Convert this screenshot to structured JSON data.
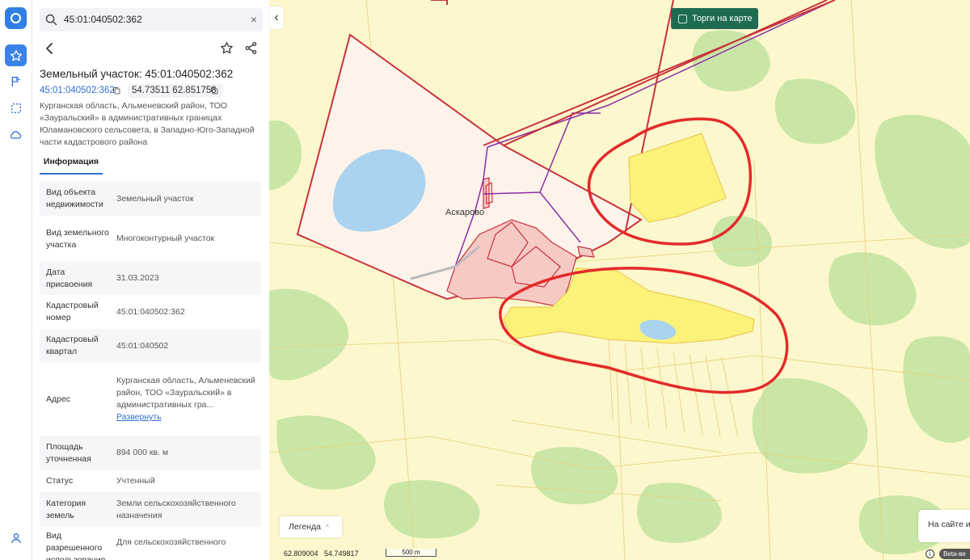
{
  "rail": {
    "icons": [
      "logo-icon",
      "star-icon",
      "route-icon",
      "selection-icon",
      "cloud-icon",
      "user-icon"
    ]
  },
  "search": {
    "value": "45:01:040502:362",
    "close_glyph": "×"
  },
  "object": {
    "title": "Земельный участок: 45:01:040502:362",
    "cadastral_link": "45:01:040502:362",
    "coords": "54.73511 62.851758",
    "address_full": "Курганская область, Альменевский район, ТОО «Зауральский» в административных границах Юламановского сельсовета, в Западно-Юго-Западной части кадастрового района"
  },
  "tabs": {
    "info": "Информация"
  },
  "table": {
    "rows": [
      {
        "k": "Вид объекта недвижимости",
        "v": "Земельный участок"
      },
      {
        "k": "Вид земельного участка",
        "v": "Многоконтурный участок"
      },
      {
        "k": "Дата присвоения",
        "v": "31.03.2023"
      },
      {
        "k": "Кадастровый номер",
        "v": "45:01:040502:362"
      },
      {
        "k": "Кадастровый квартал",
        "v": "45:01:040502"
      },
      {
        "k": "Адрес",
        "v": "Курганская область, Альменевский район, ТОО «Зауральский» в административных гра...",
        "link": "Развернуть"
      },
      {
        "k": "Площадь уточненная",
        "v": "894 000 кв. м"
      },
      {
        "k": "Статус",
        "v": "Учтенный"
      },
      {
        "k": "Категория земель",
        "v": "Земли сельскохозяйственного назначения"
      },
      {
        "k": "Вид разрешенного использования",
        "v": "Для сельскохозяйственного"
      }
    ]
  },
  "map": {
    "collapse_glyph": "‹",
    "torgi_label": "Торги на карте",
    "legend_label": "Легенда",
    "legend_chevron": "^",
    "na_site_label": "На сайте ис",
    "place_label": "Аскарово",
    "coord_lon": "62.809004",
    "coord_lat": "54.749817",
    "scale_label": "500 m",
    "info_glyph": "i",
    "beta_label": "Beta-ве",
    "colors": {
      "background": "#fcf7cc",
      "forest": "#c9e6a6",
      "water": "#a9d3ef",
      "boundary": "#c8323c",
      "highlight": "#fbf27a",
      "annotation": "#e32a2a",
      "road": "#8a2fa8"
    }
  }
}
